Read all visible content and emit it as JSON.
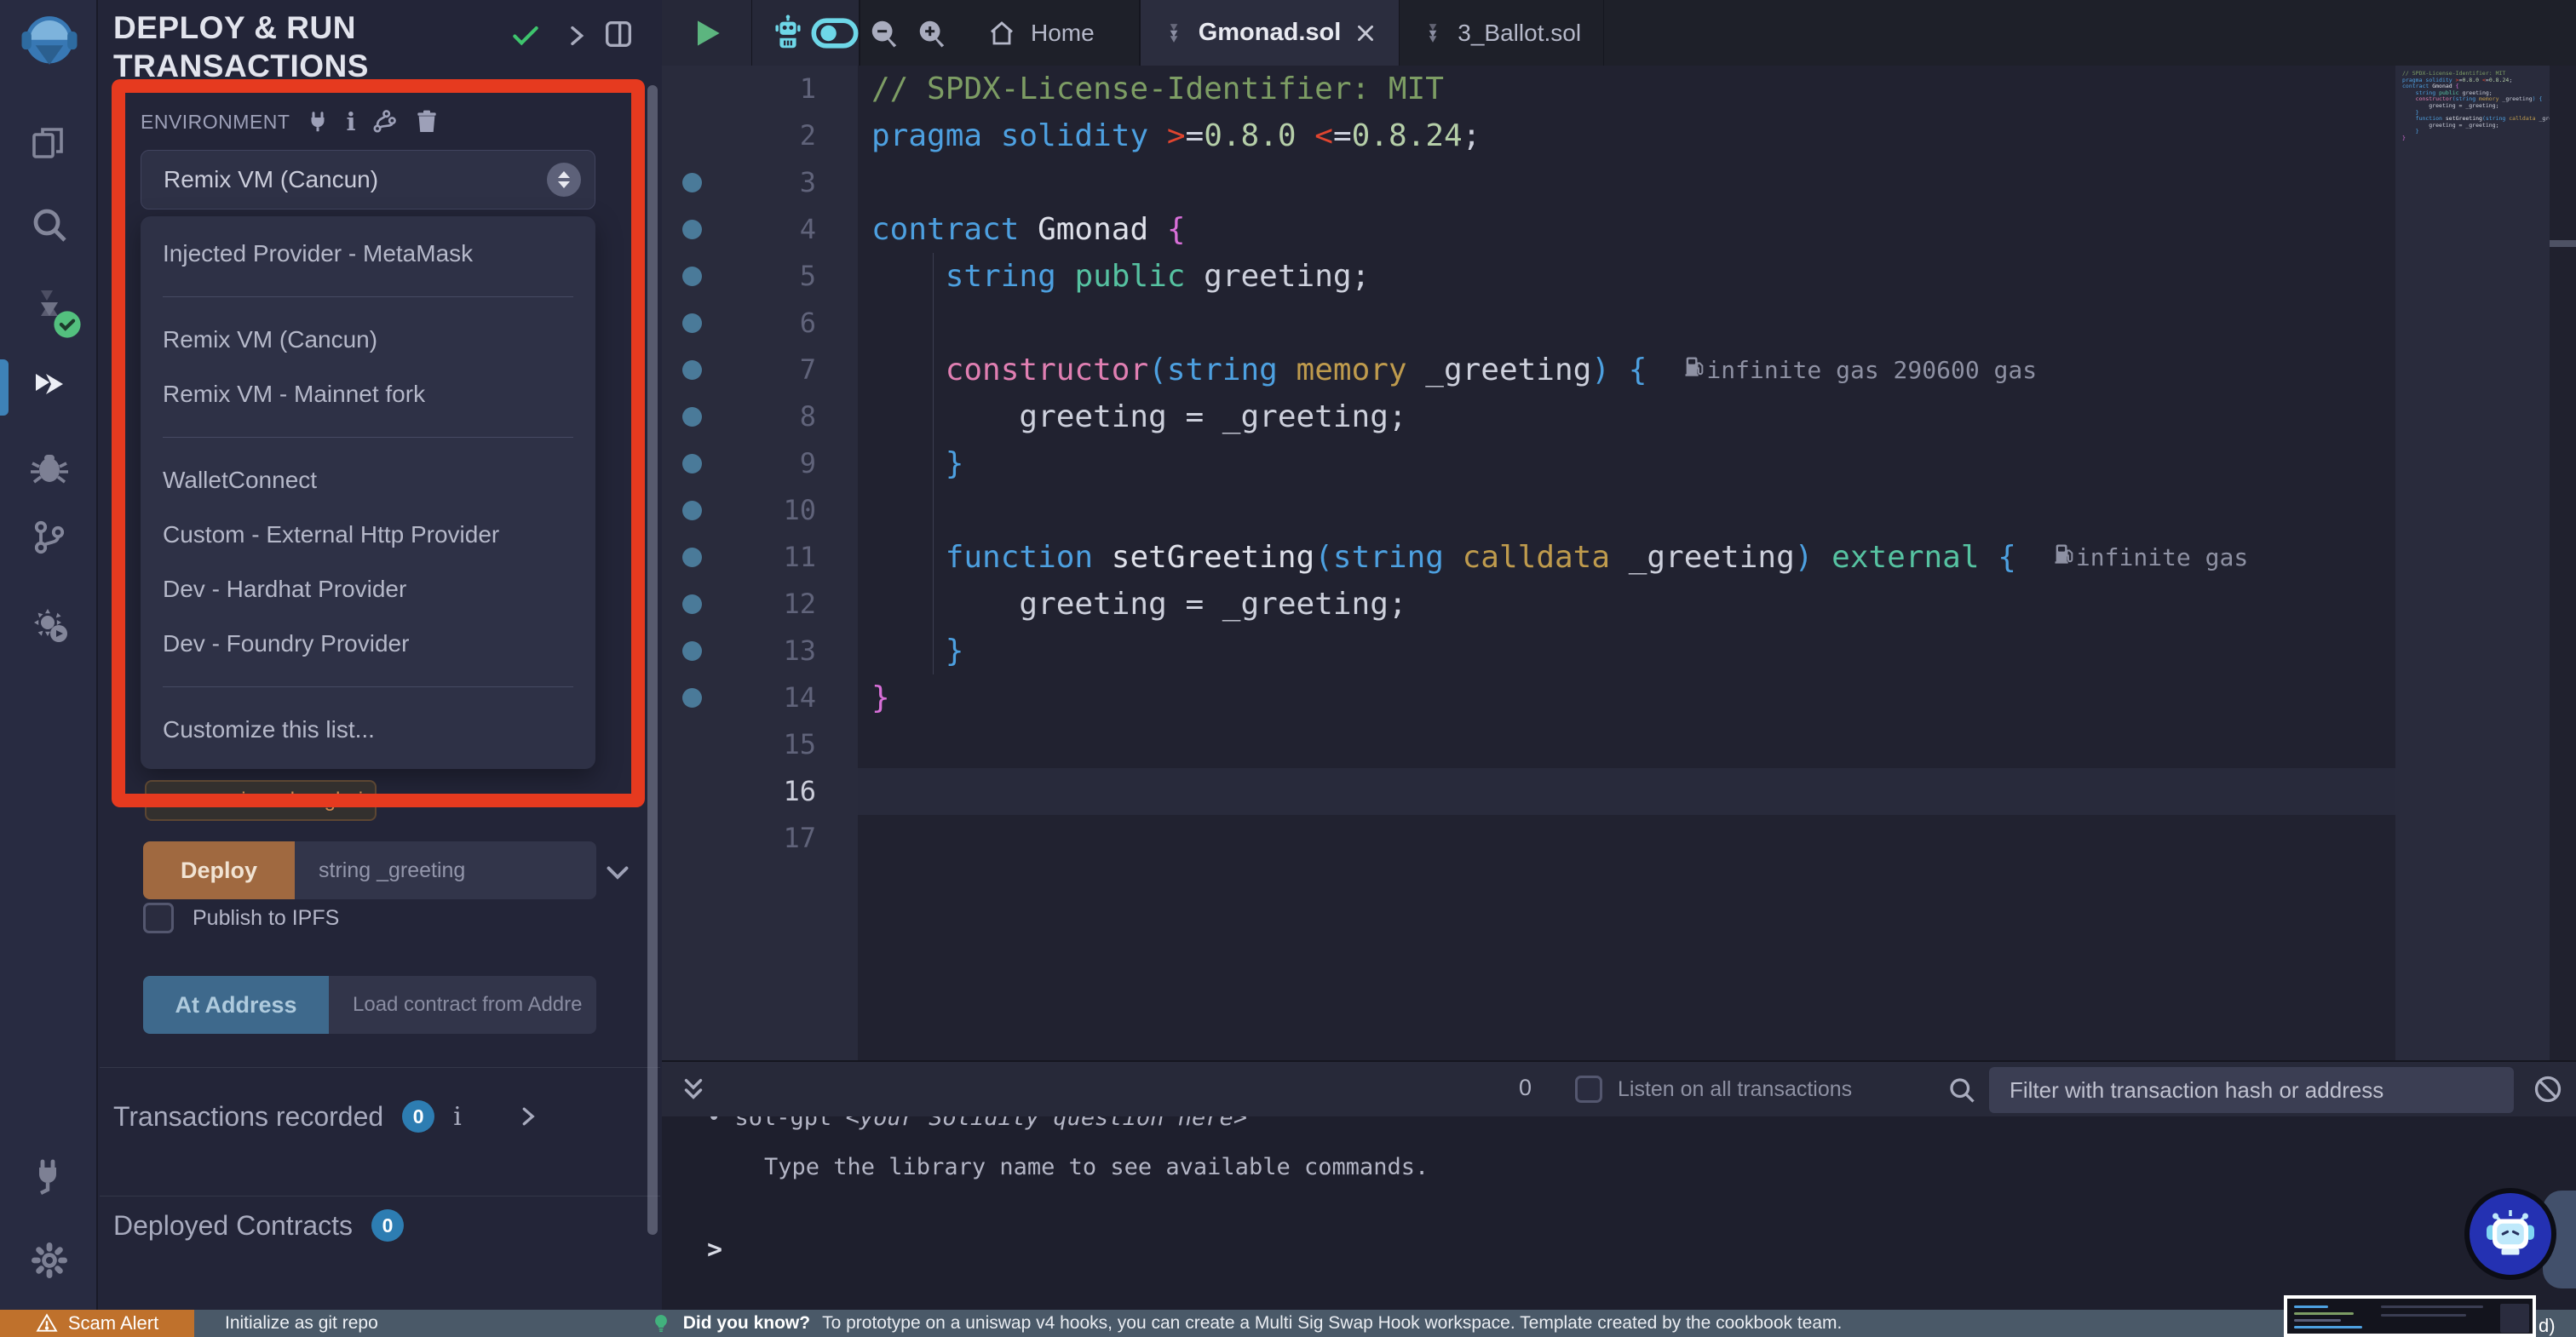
{
  "panel": {
    "title_line1": "DEPLOY & RUN",
    "title_line2": "TRANSACTIONS",
    "environment": {
      "label": "ENVIRONMENT",
      "selected": "Remix VM (Cancun)",
      "options": [
        {
          "label": "Injected Provider - MetaMask"
        },
        {
          "divider": true
        },
        {
          "label": "Remix VM (Cancun)"
        },
        {
          "label": "Remix VM - Mainnet fork"
        },
        {
          "divider": true
        },
        {
          "label": "WalletConnect"
        },
        {
          "label": "Custom - External Http Provider"
        },
        {
          "label": "Dev - Hardhat Provider"
        },
        {
          "label": "Dev - Foundry Provider"
        },
        {
          "divider": true
        },
        {
          "label": "Customize this list..."
        }
      ]
    },
    "evm_chip": "evm version: shanghai",
    "deploy": {
      "button": "Deploy",
      "placeholder": "string _greeting"
    },
    "publish_label": "Publish to IPFS",
    "at_address": {
      "button": "At Address",
      "placeholder": "Load contract from Addre"
    },
    "transactions": {
      "label": "Transactions recorded",
      "count": "0"
    },
    "deployed": {
      "label": "Deployed Contracts",
      "count": "0"
    }
  },
  "editor": {
    "tabs": [
      {
        "label": "Home"
      },
      {
        "label": "Gmonad.sol",
        "active": true
      },
      {
        "label": "3_Ballot.sol"
      }
    ],
    "current_line": 16,
    "total_lines": 17,
    "token_colors": {
      "comment": "#7d9d64",
      "kw": "#4da0e0",
      "num": "#b5cea8",
      "op": "#e0452f",
      "plain": "#cdd0dc",
      "bracket1": "#4da0e0",
      "bracket2": "#d86fd8",
      "ctor": "#e07fb2",
      "yellow": "#bf9b4d",
      "green": "#56c2a1",
      "fname": "#dfe1ea"
    },
    "lines": [
      {
        "n": 1,
        "dot": false,
        "tokens": [
          {
            "t": "// SPDX-License-Identifier: MIT",
            "c": "comment"
          }
        ]
      },
      {
        "n": 2,
        "dot": false,
        "tokens": [
          {
            "t": "pragma",
            "c": "kw"
          },
          {
            "t": " ",
            "c": "plain"
          },
          {
            "t": "solidity",
            "c": "kw"
          },
          {
            "t": " ",
            "c": "plain"
          },
          {
            "t": ">",
            "c": "op"
          },
          {
            "t": "=",
            "c": "plain"
          },
          {
            "t": "0.8.0",
            "c": "num"
          },
          {
            "t": " ",
            "c": "plain"
          },
          {
            "t": "<",
            "c": "op"
          },
          {
            "t": "=",
            "c": "plain"
          },
          {
            "t": "0.8.24",
            "c": "num"
          },
          {
            "t": ";",
            "c": "plain"
          }
        ]
      },
      {
        "n": 3,
        "dot": true,
        "tokens": []
      },
      {
        "n": 4,
        "dot": true,
        "tokens": [
          {
            "t": "contract",
            "c": "kw"
          },
          {
            "t": " ",
            "c": "plain"
          },
          {
            "t": "Gmonad",
            "c": "fname"
          },
          {
            "t": " ",
            "c": "plain"
          },
          {
            "t": "{",
            "c": "bracket2"
          }
        ]
      },
      {
        "n": 5,
        "dot": true,
        "tokens": [
          {
            "t": "    ",
            "c": "plain"
          },
          {
            "t": "string",
            "c": "kw"
          },
          {
            "t": " ",
            "c": "plain"
          },
          {
            "t": "public",
            "c": "green"
          },
          {
            "t": " greeting;",
            "c": "plain"
          }
        ]
      },
      {
        "n": 6,
        "dot": true,
        "tokens": []
      },
      {
        "n": 7,
        "dot": true,
        "gas": "infinite gas 290600 gas",
        "tokens": [
          {
            "t": "    ",
            "c": "plain"
          },
          {
            "t": "constructor",
            "c": "ctor"
          },
          {
            "t": "(",
            "c": "bracket1"
          },
          {
            "t": "string",
            "c": "kw"
          },
          {
            "t": " ",
            "c": "plain"
          },
          {
            "t": "memory",
            "c": "yellow"
          },
          {
            "t": " _greeting",
            "c": "plain"
          },
          {
            "t": ")",
            "c": "bracket1"
          },
          {
            "t": " ",
            "c": "plain"
          },
          {
            "t": "{",
            "c": "bracket1"
          }
        ]
      },
      {
        "n": 8,
        "dot": true,
        "tokens": [
          {
            "t": "        greeting = _greeting;",
            "c": "plain"
          }
        ]
      },
      {
        "n": 9,
        "dot": true,
        "tokens": [
          {
            "t": "    ",
            "c": "plain"
          },
          {
            "t": "}",
            "c": "bracket1"
          }
        ]
      },
      {
        "n": 10,
        "dot": true,
        "tokens": []
      },
      {
        "n": 11,
        "dot": true,
        "gas": "infinite gas",
        "tokens": [
          {
            "t": "    ",
            "c": "plain"
          },
          {
            "t": "function",
            "c": "kw"
          },
          {
            "t": " ",
            "c": "plain"
          },
          {
            "t": "setGreeting",
            "c": "fname"
          },
          {
            "t": "(",
            "c": "bracket1"
          },
          {
            "t": "string",
            "c": "kw"
          },
          {
            "t": " ",
            "c": "plain"
          },
          {
            "t": "calldata",
            "c": "yellow"
          },
          {
            "t": " _greeting",
            "c": "plain"
          },
          {
            "t": ")",
            "c": "bracket1"
          },
          {
            "t": " ",
            "c": "plain"
          },
          {
            "t": "external",
            "c": "green"
          },
          {
            "t": " ",
            "c": "plain"
          },
          {
            "t": "{",
            "c": "bracket1"
          }
        ]
      },
      {
        "n": 12,
        "dot": true,
        "tokens": [
          {
            "t": "        greeting = _greeting;",
            "c": "plain"
          }
        ]
      },
      {
        "n": 13,
        "dot": true,
        "tokens": [
          {
            "t": "    ",
            "c": "plain"
          },
          {
            "t": "}",
            "c": "bracket1"
          }
        ]
      },
      {
        "n": 14,
        "dot": true,
        "tokens": [
          {
            "t": "}",
            "c": "bracket2"
          }
        ]
      },
      {
        "n": 15,
        "dot": false,
        "tokens": []
      },
      {
        "n": 16,
        "dot": false,
        "tokens": []
      },
      {
        "n": 17,
        "dot": false,
        "tokens": []
      }
    ]
  },
  "terminal": {
    "count": "0",
    "listen_label": "Listen on all transactions",
    "filter_placeholder": "Filter with transaction hash or address",
    "line1_prefix": "• sol-gpt ",
    "line1_italic": "<your Solidity question here>",
    "hint": "Type the library name to see available commands.",
    "prompt": ">"
  },
  "statusbar": {
    "scam_label": "Scam Alert",
    "git_label": "Initialize as git repo",
    "tip_bold": "Did you know?",
    "tip_text": "To prototype on a uniswap v4 hooks, you can create a Multi Sig Swap Hook workspace. Template created by the cookbook team.",
    "clipped_text": "d)"
  },
  "colors": {
    "accent_red_annotation": "#e63a1f",
    "deploy_orange": "#a06940",
    "at_address_blue": "#3e698c",
    "badge_blue": "#2d7db2",
    "scam_orange": "#bf712c",
    "status_slate": "#4a5968",
    "run_green": "#5cb57f",
    "ai_cyan": "#6ed7e8",
    "check_green": "#3ec46d"
  }
}
